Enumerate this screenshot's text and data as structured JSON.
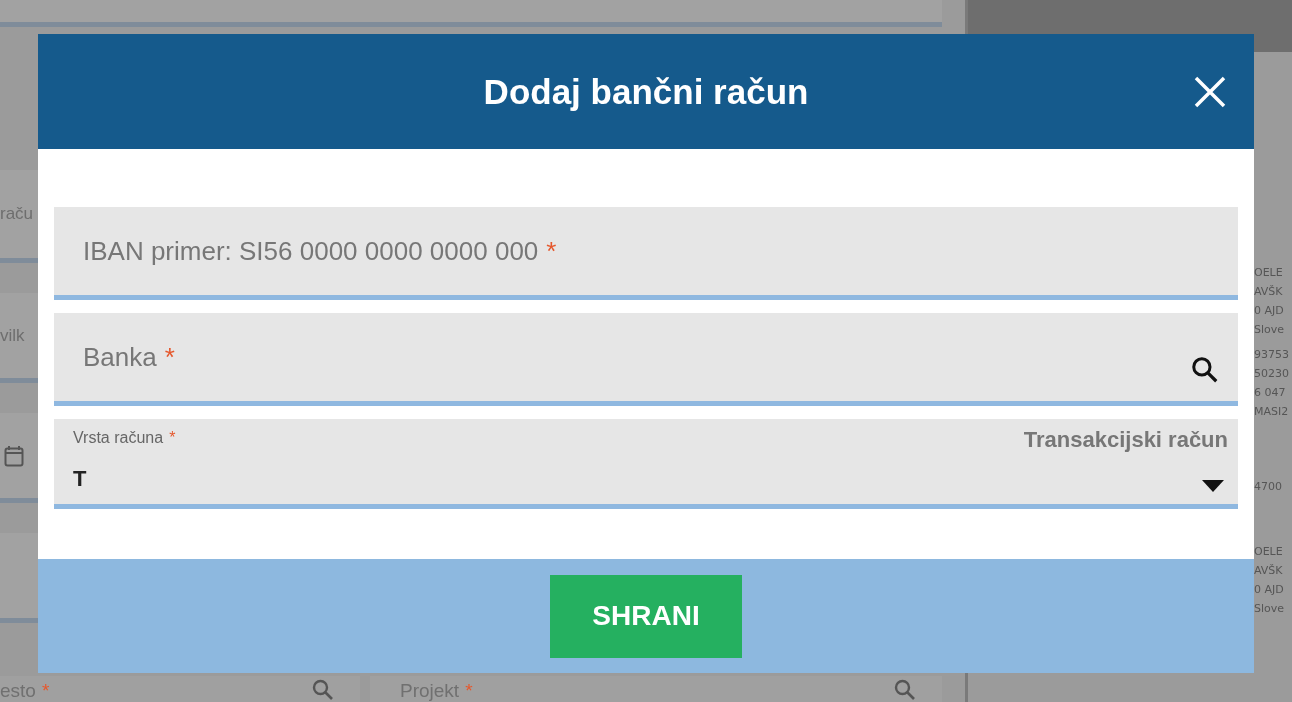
{
  "background": {
    "left_labels": [
      {
        "text": "raču"
      },
      {
        "text": "vilk"
      }
    ],
    "bottom_fields": [
      {
        "label": "esto",
        "mark": "*"
      },
      {
        "label": "Projekt",
        "mark": "*"
      }
    ],
    "side_groups": [
      [
        "OELE",
        "AVŠK",
        "0 AJD",
        "Slove"
      ],
      [
        "93753",
        "50230",
        "6 047",
        "MASI2"
      ],
      [
        "4700"
      ],
      [
        "OELE",
        "AVŠK",
        "0 AJD",
        "Slove"
      ]
    ]
  },
  "dialog": {
    "title": "Dodaj bančni račun",
    "fields": [
      {
        "kind": "text",
        "placeholder": "IBAN primer: SI56 0000 0000 0000 000",
        "mark": "*"
      },
      {
        "kind": "search",
        "placeholder": "Banka",
        "mark": "*"
      },
      {
        "kind": "select",
        "label": "Vrsta računa",
        "mark": "*",
        "value": "T",
        "option": "Transakcijski račun"
      }
    ],
    "save_button": "SHRANI"
  }
}
